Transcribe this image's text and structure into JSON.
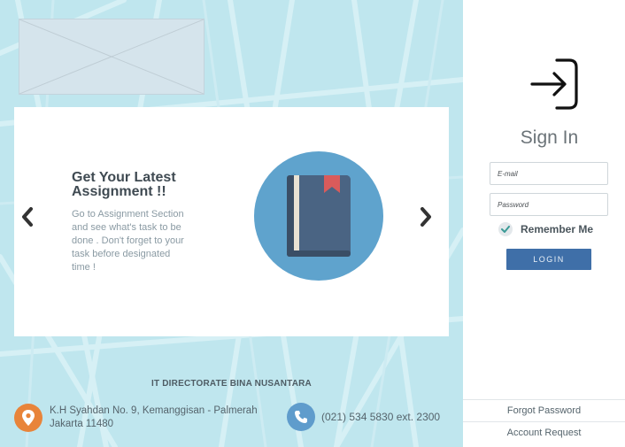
{
  "logo": {
    "alt": ""
  },
  "carousel": {
    "prev_icon": "chevron-left-icon",
    "next_icon": "chevron-right-icon",
    "slide": {
      "title": "Get Your Latest Assignment  !!",
      "description": "Go to Assignment Section and see what's task to be done . Don't forget to your task before designated time !",
      "image_icon": "book-icon"
    }
  },
  "footer": {
    "organization": "IT DIRECTORATE BINA NUSANTARA",
    "address_icon": "location-pin-icon",
    "address_line1": "K.H Syahdan No. 9, Kemanggisan - Palmerah",
    "address_line2": "Jakarta 11480",
    "phone_icon": "phone-icon",
    "phone": "(021) 534 5830 ext. 2300"
  },
  "signin": {
    "icon": "sign-in-icon",
    "title": "Sign In",
    "email_placeholder": "E-mail",
    "password_placeholder": "Password",
    "remember_label": "Remember Me",
    "remember_checked": true,
    "login_label": "LOGIN",
    "forgot_link": "Forgot Password",
    "request_link": "Account Request"
  },
  "colors": {
    "background_left": "#bfe6ee",
    "carousel_bg": "#ffffff",
    "book_circle": "#5fa3cd",
    "login_button": "#3f6fa8",
    "address_icon_bg": "#e8843a",
    "phone_icon_bg": "#5f9ccc"
  }
}
